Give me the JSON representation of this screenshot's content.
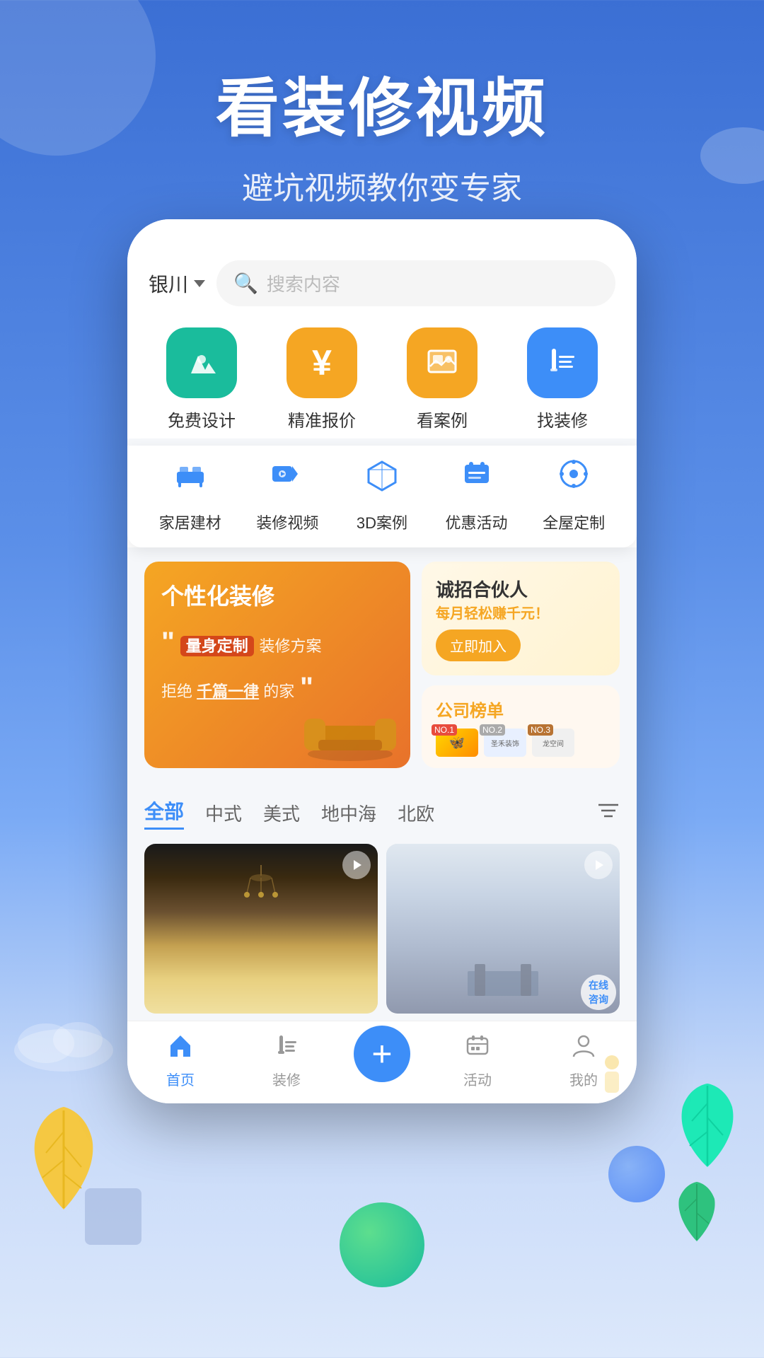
{
  "header": {
    "main_title": "看装修视频",
    "sub_title": "避坑视频教你变专家"
  },
  "search": {
    "location": "银川",
    "placeholder": "搜索内容"
  },
  "category_row1": [
    {
      "label": "免费设计",
      "icon": "✏️",
      "color": "green"
    },
    {
      "label": "精准报价",
      "icon": "¥",
      "color": "orange"
    },
    {
      "label": "看案例",
      "icon": "🖼️",
      "color": "amber"
    },
    {
      "label": "找装修",
      "icon": "🖌️",
      "color": "blue"
    }
  ],
  "category_row2": [
    {
      "label": "家居建材",
      "icon": "🛋️"
    },
    {
      "label": "装修视频",
      "icon": "📹"
    },
    {
      "label": "3D案例",
      "icon": "📦"
    },
    {
      "label": "优惠活动",
      "icon": "🎁"
    },
    {
      "label": "全屋定制",
      "icon": "📷"
    }
  ],
  "banner_left": {
    "title": "个性化装修",
    "quote_open": "❝",
    "highlight": "量身定制",
    "sub1": "装修方案",
    "sub2": "拒绝",
    "highlight2": "千篇一律",
    "sub3": "的家",
    "quote_close": "❞"
  },
  "banner_right_top": {
    "title": "诚招合伙人",
    "sub": "每月轻松赚千元！",
    "btn": "立即加入"
  },
  "banner_right_bottom": {
    "title": "公司",
    "title_highlight": "榜单",
    "logos": [
      "NO.1",
      "NO.2",
      "NO.3"
    ]
  },
  "style_tabs": [
    {
      "label": "全部",
      "active": true
    },
    {
      "label": "中式"
    },
    {
      "label": "美式"
    },
    {
      "label": "地中海"
    },
    {
      "label": "北欧"
    }
  ],
  "bottom_nav": [
    {
      "label": "首页",
      "icon": "🏠",
      "active": true
    },
    {
      "label": "装修",
      "icon": "✏️"
    },
    {
      "label": "+",
      "is_add": true
    },
    {
      "label": "活动",
      "icon": "🎁"
    },
    {
      "label": "我的",
      "icon": "👤"
    }
  ],
  "consult_btn": "在线咨询",
  "colors": {
    "primary": "#3d8ef8",
    "orange": "#f5a623",
    "green": "#1abc9c",
    "bg": "#3b6fd4"
  }
}
